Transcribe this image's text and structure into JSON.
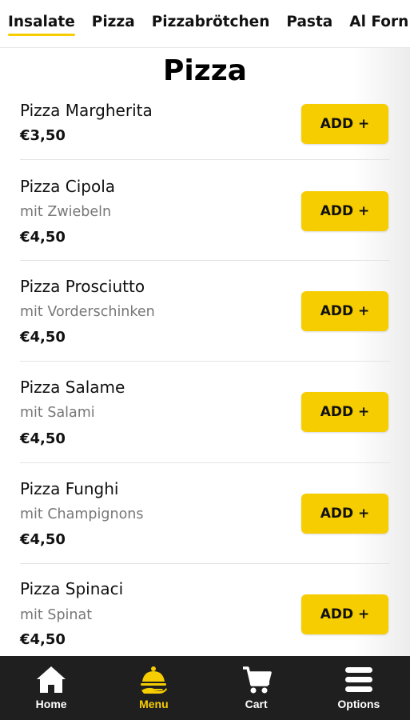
{
  "tabs": [
    {
      "label": "Insalate",
      "active": true
    },
    {
      "label": "Pizza",
      "active": false
    },
    {
      "label": "Pizzabrötchen",
      "active": false
    },
    {
      "label": "Pasta",
      "active": false
    },
    {
      "label": "Al Forn",
      "active": false
    }
  ],
  "page_title": "Pizza",
  "items": [
    {
      "name": "Pizza Margherita",
      "desc": "",
      "price": "€3,50",
      "button": "ADD +"
    },
    {
      "name": "Pizza Cipola",
      "desc": "mit Zwiebeln",
      "price": "€4,50",
      "button": "ADD +"
    },
    {
      "name": "Pizza Prosciutto",
      "desc": "mit Vorderschinken",
      "price": "€4,50",
      "button": "ADD +"
    },
    {
      "name": "Pizza Salame",
      "desc": "mit Salami",
      "price": "€4,50",
      "button": "ADD +"
    },
    {
      "name": "Pizza Funghi",
      "desc": "mit Champignons",
      "price": "€4,50",
      "button": "ADD +"
    },
    {
      "name": "Pizza Spinaci",
      "desc": "mit Spinat",
      "price": "€4,50",
      "button": "ADD +"
    }
  ],
  "nav": [
    {
      "label": "Home",
      "icon": "home-icon",
      "active": false
    },
    {
      "label": "Menu",
      "icon": "menu-cloche-icon",
      "active": true
    },
    {
      "label": "Cart",
      "icon": "cart-icon",
      "active": false
    },
    {
      "label": "Options",
      "icon": "options-icon",
      "active": false
    }
  ],
  "colors": {
    "accent": "#f6cd00",
    "nav_bg": "#1f1f1f"
  }
}
